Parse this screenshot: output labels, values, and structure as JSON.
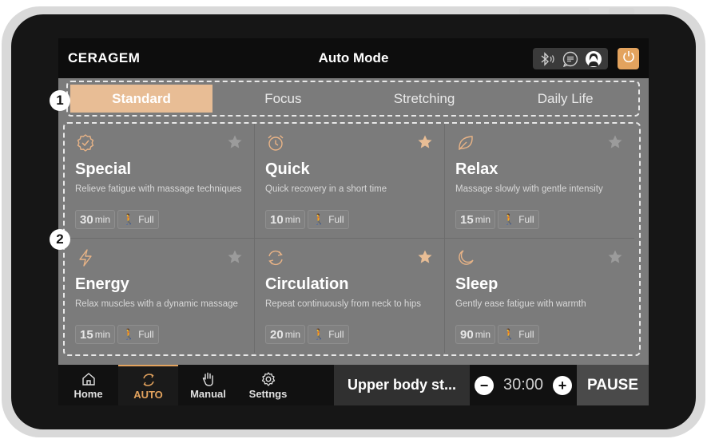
{
  "header": {
    "logo": "CERAGEM",
    "title": "Auto Mode",
    "status_icons": [
      "bluetooth-icon",
      "message-icon",
      "user-avatar"
    ],
    "power_icon": "power-icon"
  },
  "tabs": [
    {
      "label": "Standard",
      "active": true
    },
    {
      "label": "Focus",
      "active": false
    },
    {
      "label": "Stretching",
      "active": false
    },
    {
      "label": "Daily Life",
      "active": false
    }
  ],
  "callouts": {
    "tabs_number": "1",
    "grid_number": "2"
  },
  "programs": [
    {
      "name": "Special",
      "description": "Relieve fatigue with massage techniques",
      "time": "30",
      "unit": "min",
      "area": "Full",
      "icon": "badge-check-icon",
      "favorite": false
    },
    {
      "name": "Quick",
      "description": "Quick recovery in a short time",
      "time": "10",
      "unit": "min",
      "area": "Full",
      "icon": "alarm-clock-icon",
      "favorite": true
    },
    {
      "name": "Relax",
      "description": "Massage slowly with gentle intensity",
      "time": "15",
      "unit": "min",
      "area": "Full",
      "icon": "leaf-icon",
      "favorite": false
    },
    {
      "name": "Energy",
      "description": "Relax muscles with a dynamic massage",
      "time": "15",
      "unit": "min",
      "area": "Full",
      "icon": "lightning-icon",
      "favorite": false
    },
    {
      "name": "Circulation",
      "description": "Repeat continuously from neck to hips",
      "time": "20",
      "unit": "min",
      "area": "Full",
      "icon": "refresh-icon",
      "favorite": true
    },
    {
      "name": "Sleep",
      "description": "Gently ease fatigue with warmth",
      "time": "90",
      "unit": "min",
      "area": "Full",
      "icon": "moon-icon",
      "favorite": false
    }
  ],
  "nav": [
    {
      "label": "Home",
      "icon": "home-icon",
      "active": false
    },
    {
      "label": "AUTO",
      "icon": "auto-icon",
      "active": true
    },
    {
      "label": "Manual",
      "icon": "hand-icon",
      "active": false
    },
    {
      "label": "Settngs",
      "icon": "gear-icon",
      "active": false
    }
  ],
  "player": {
    "program": "Upper body st...",
    "minus": "−",
    "time": "30:00",
    "plus": "+",
    "pause": "PAUSE"
  },
  "colors": {
    "accent": "#e3a35e",
    "active_tab": "#e8bd95",
    "screen": "#7b7b7b",
    "bar": "#111111"
  }
}
